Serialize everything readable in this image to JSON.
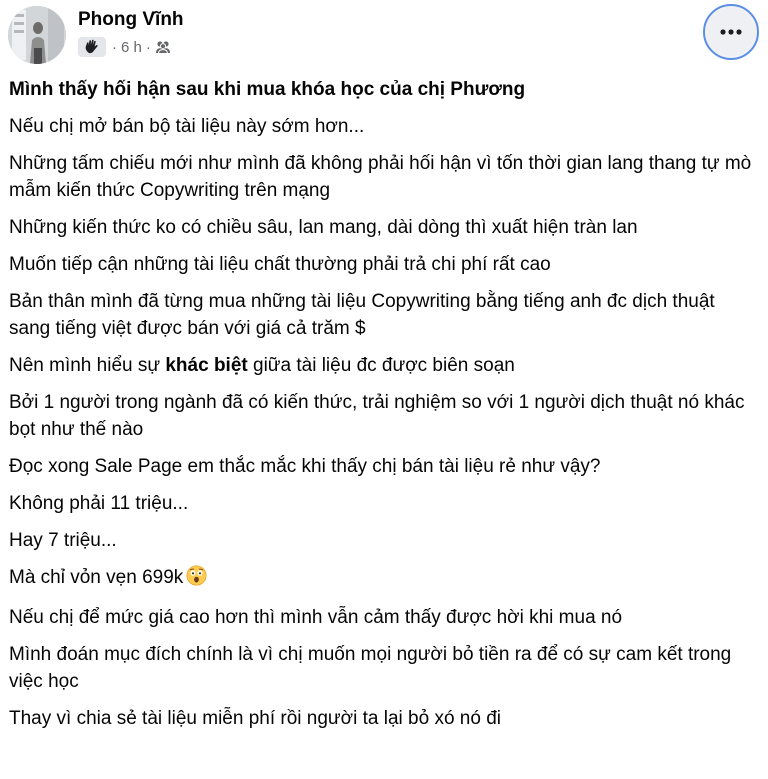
{
  "author": {
    "name": "Phong Vĩnh",
    "avatar_alt": ""
  },
  "meta": {
    "badge_icon": "hand-wave-icon",
    "separator": "·",
    "time": "6 h",
    "privacy_icon": "friends-icon"
  },
  "more_button": {
    "icon": "more-horizontal-icon",
    "focus_color": "#5b8fe6"
  },
  "post": {
    "title": "Mình thấy hối hận sau khi mua khóa học của chị Phương",
    "paragraphs": [
      "Nếu chị mở bán bộ tài liệu này sớm hơn...",
      "Những tấm chiếu mới như mình đã không phải hối hận vì tốn thời gian lang thang tự mò mẫm kiến thức Copywriting trên mạng",
      "Những kiến thức ko có chiều sâu, lan mang, dài dòng thì xuất hiện tràn lan",
      "Muốn tiếp cận những tài liệu chất thường phải trả chi phí rất cao",
      "Bản thân mình đã từng mua những tài liệu Copywriting bằng tiếng anh đc dịch thuật sang tiếng việt được bán với giá cả trăm $"
    ],
    "emphasis_paragraph": {
      "before": "Nên mình hiểu sự ",
      "bold": "khác biệt",
      "after": " giữa tài liệu đc được biên soạn"
    },
    "paragraphs_2": [
      "Bởi 1 người trong ngành đã có kiến thức, trải nghiệm so với 1 người dịch thuật nó khác bọt như thế nào",
      "Đọc xong Sale Page em thắc mắc khi thấy chị bán tài liệu rẻ như vậy?",
      "Không phải 11 triệu...",
      "Hay 7 triệu..."
    ],
    "price_paragraph": {
      "text": "Mà chỉ vỏn vẹn 699k",
      "emoji": "astonished-face-emoji"
    },
    "paragraphs_3": [
      "Nếu chị để mức giá cao hơn thì mình vẫn cảm thấy được hời khi mua nó",
      "Mình đoán mục đích chính là vì chị muốn mọi người bỏ tiền ra để có sự cam kết trong việc học",
      "Thay vì chia sẻ tài liệu miễn phí rồi người ta lại bỏ xó nó đi"
    ]
  },
  "colors": {
    "text_primary": "#050505",
    "text_secondary": "#65676b",
    "badge_bg": "#e4e6eb",
    "button_bg": "#f0f2f5"
  }
}
